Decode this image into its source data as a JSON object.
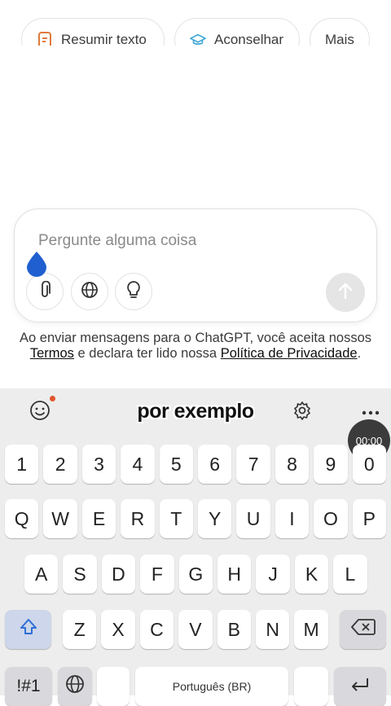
{
  "chips": [
    {
      "label": "Resumir texto",
      "icon": "document-icon",
      "color": "#e07a3a"
    },
    {
      "label": "Aconselhar",
      "icon": "graduation-cap-icon",
      "color": "#3fa7d6"
    },
    {
      "label": "Mais",
      "icon": "",
      "color": ""
    }
  ],
  "composer": {
    "placeholder": "Pergunte alguma coisa",
    "tools": [
      "paperclip-icon",
      "globe-icon",
      "lightbulb-icon"
    ],
    "send_icon": "arrow-up-icon"
  },
  "legal": {
    "prefix": "Ao enviar mensagens para o ChatGPT, você aceita nossos ",
    "terms": "Termos",
    "middle": " e declara ter lido nossa ",
    "privacy": "Política de Privacidade",
    "suffix": "."
  },
  "keyboard": {
    "caption": "por exemplo",
    "timer": "00:00",
    "row_numbers": [
      "1",
      "2",
      "3",
      "4",
      "5",
      "6",
      "7",
      "8",
      "9",
      "0"
    ],
    "row1": [
      "Q",
      "W",
      "E",
      "R",
      "T",
      "Y",
      "U",
      "I",
      "O",
      "P"
    ],
    "row2": [
      "A",
      "S",
      "D",
      "F",
      "G",
      "H",
      "J",
      "K",
      "L"
    ],
    "row3": [
      "Z",
      "X",
      "C",
      "V",
      "B",
      "N",
      "M"
    ],
    "symbols_label": "!#1",
    "space_label": "Português (BR)",
    "accent_color": "#2f6fd6"
  }
}
